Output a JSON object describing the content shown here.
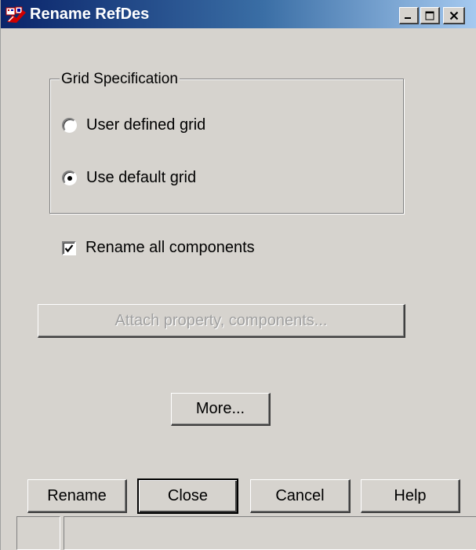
{
  "window": {
    "title": "Rename RefDes",
    "icons": {
      "app": "rename-refdes-app-icon",
      "minimize": "minimize-icon",
      "maximize": "maximize-icon",
      "close": "close-icon"
    }
  },
  "grid_spec": {
    "legend": "Grid Specification",
    "options": [
      {
        "label": "User defined grid",
        "selected": false
      },
      {
        "label": "Use default grid",
        "selected": true
      }
    ]
  },
  "rename_all": {
    "label": "Rename all components",
    "checked": true
  },
  "attach_button": {
    "label": "Attach property, components...",
    "enabled": false
  },
  "more_button": {
    "label": "More..."
  },
  "bottom_buttons": {
    "rename": "Rename",
    "close": "Close",
    "cancel": "Cancel",
    "help": "Help"
  },
  "colors": {
    "face": "#d6d3ce",
    "title_start": "#0a246a",
    "title_end": "#a6caf0",
    "disabled_text": "#a0a0a0"
  }
}
